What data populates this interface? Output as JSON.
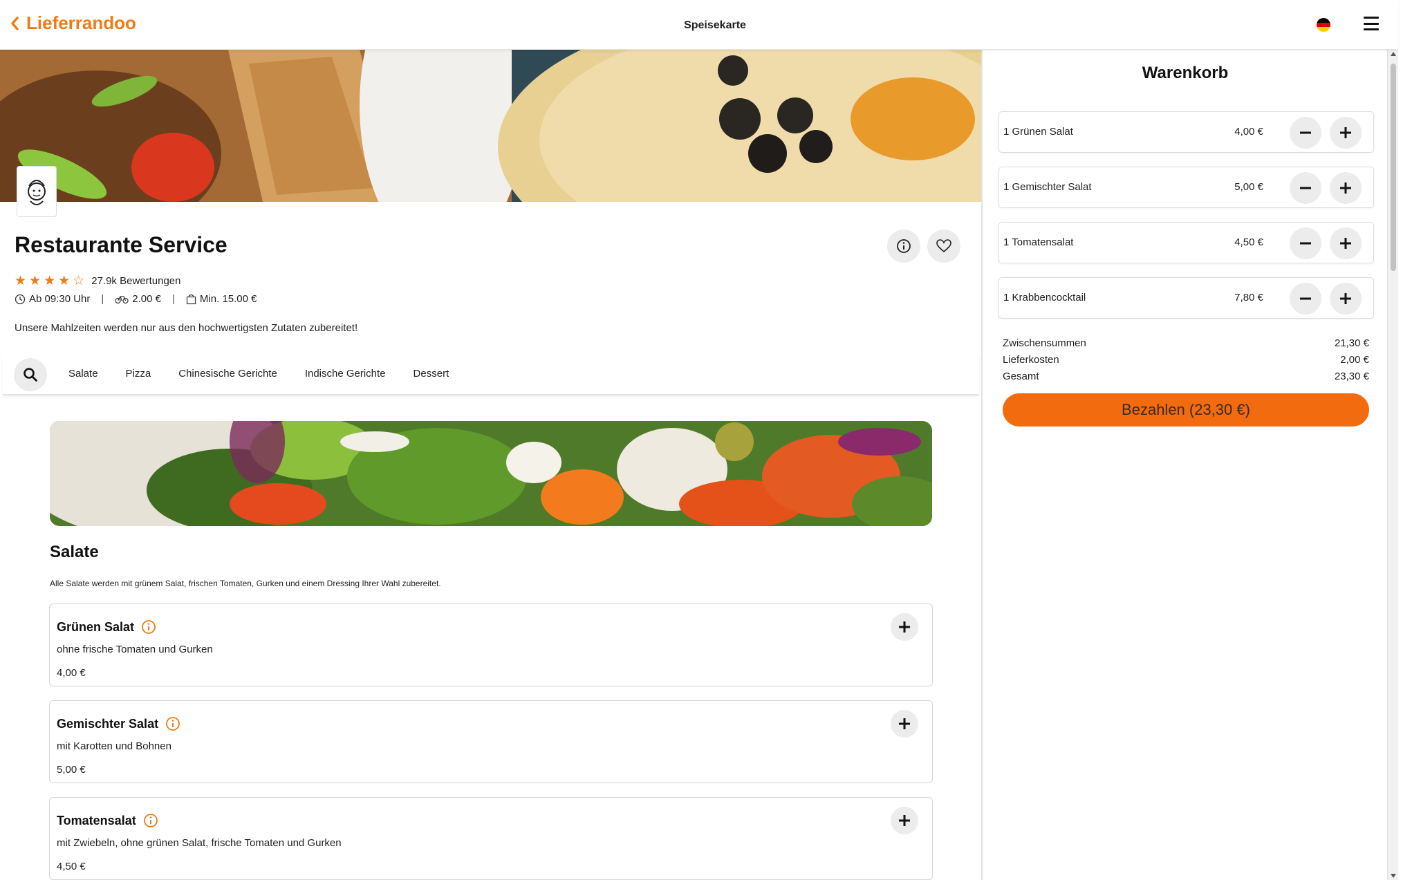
{
  "header": {
    "brand": "Lieferrandoo",
    "page_title": "Speisekarte",
    "language_icon": "german-flag-icon",
    "menu_icon": "hamburger-menu-icon"
  },
  "restaurant": {
    "name": "Restaurante Service",
    "rating_stars": 4,
    "rating_max": 5,
    "reviews": "27.9k Bewertungen",
    "opening": "Ab 09:30 Uhr",
    "delivery_fee": "2.00 €",
    "min_order": "Min. 15.00 €",
    "tagline": "Unsere Mahlzeiten werden nur aus den hochwertigsten Zutaten zubereitet!"
  },
  "categories": [
    "Salate",
    "Pizza",
    "Chinesische Gerichte",
    "Indische Gerichte",
    "Dessert"
  ],
  "section": {
    "title": "Salate",
    "description": "Alle Salate werden mit grünem Salat, frischen Tomaten, Gurken und einem Dressing Ihrer Wahl zubereitet."
  },
  "menu_items": [
    {
      "name": "Grünen Salat",
      "description": "ohne frische Tomaten und Gurken",
      "price": "4,00 €"
    },
    {
      "name": "Gemischter Salat",
      "description": "mit Karotten und Bohnen",
      "price": "5,00 €"
    },
    {
      "name": "Tomatensalat",
      "description": "mit Zwiebeln, ohne grünen Salat, frische Tomaten und Gurken",
      "price": "4,50 €"
    }
  ],
  "cart": {
    "title": "Warenkorb",
    "items": [
      {
        "label": "1 Grünen Salat",
        "amount": "4,00 €"
      },
      {
        "label": "1 Gemischter Salat",
        "amount": "5,00 €"
      },
      {
        "label": "1 Tomatensalat",
        "amount": "4,50 €"
      },
      {
        "label": "1 Krabbencocktail",
        "amount": "7,80 €"
      }
    ],
    "subtotal_label": "Zwischensummen",
    "subtotal": "21,30 €",
    "delivery_label": "Lieferkosten",
    "delivery": "2,00 €",
    "total_label": "Gesamt",
    "total": "23,30 €",
    "pay_button": "Bezahlen (23,30 €)"
  },
  "colors": {
    "accent": "#f07b14",
    "pay_button": "#f26b0f"
  }
}
